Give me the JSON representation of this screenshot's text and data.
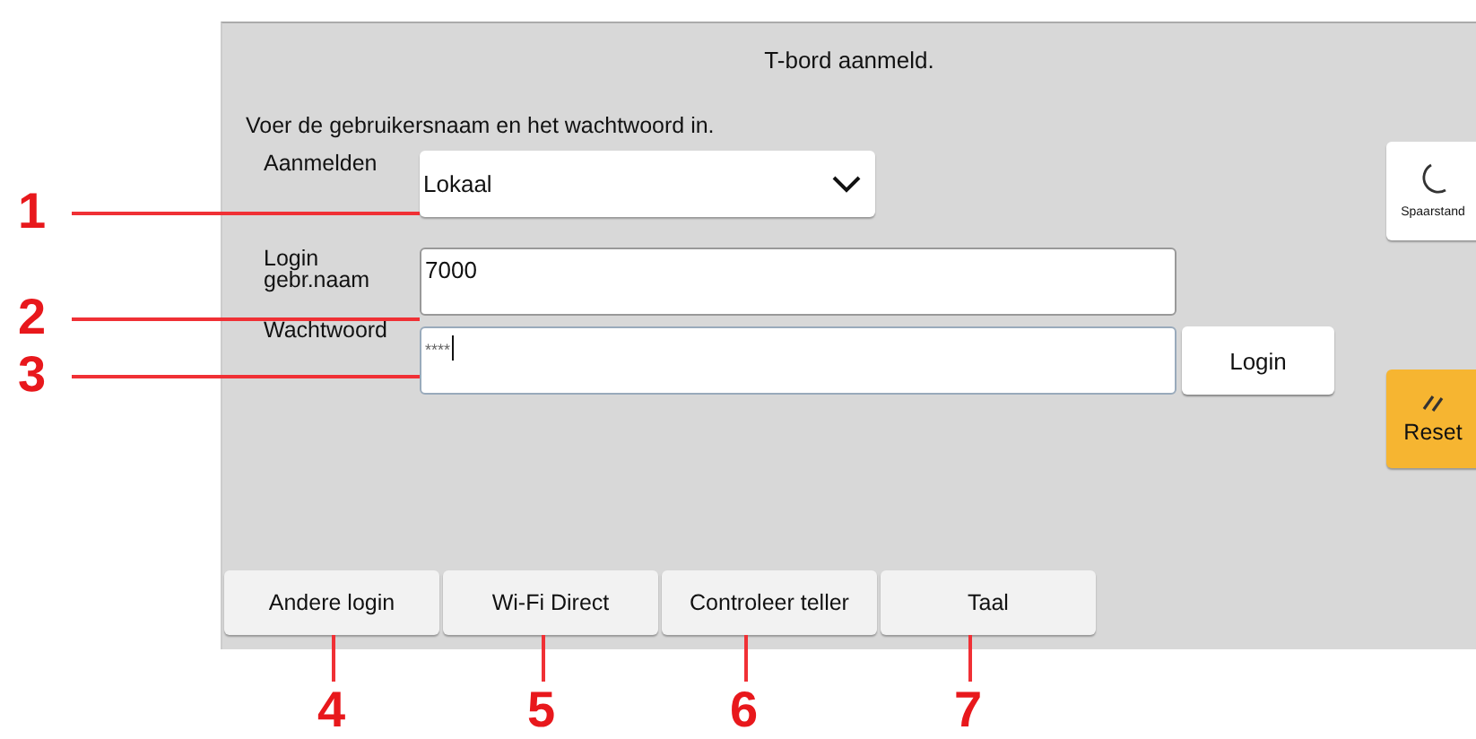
{
  "title": "T-bord aanmeld.",
  "instruction": "Voer de gebruikersnaam en het wachtwoord in.",
  "login_method": {
    "label": "Aanmelden",
    "value": "Lokaal"
  },
  "username": {
    "label": "Login gebr.naam",
    "value": "7000"
  },
  "password": {
    "label": "Wachtwoord",
    "value": "****"
  },
  "login_button": "Login",
  "side_buttons": [
    {
      "kind": "sleep",
      "label": "Spaarstand"
    },
    {
      "kind": "reset",
      "label": "Reset"
    }
  ],
  "bottom_buttons": [
    "Andere login",
    "Wi-Fi Direct",
    "Controleer teller",
    "Taal"
  ],
  "callouts": [
    "1",
    "2",
    "3",
    "4",
    "5",
    "6",
    "7"
  ]
}
